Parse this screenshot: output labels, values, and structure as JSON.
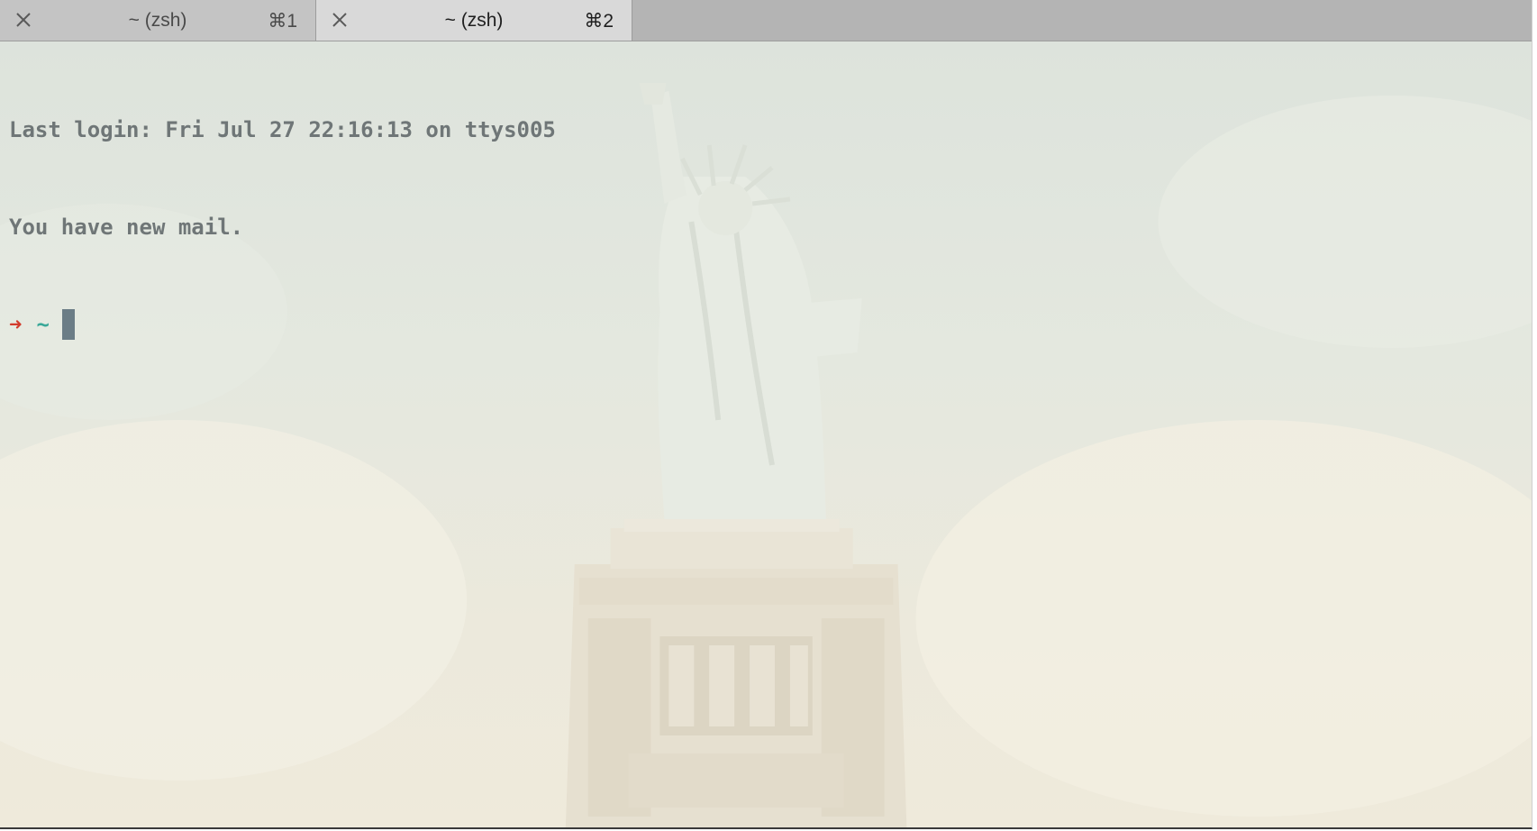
{
  "tabs": [
    {
      "title": "~ (zsh)",
      "shortcut": "⌘1",
      "active": false,
      "close_icon": "close-icon"
    },
    {
      "title": "~ (zsh)",
      "shortcut": "⌘2",
      "active": true,
      "close_icon": "close-icon"
    }
  ],
  "terminal": {
    "lines": [
      "Last login: Fri Jul 27 22:16:13 on ttys005",
      "You have new mail."
    ],
    "prompt": {
      "arrow": "➜",
      "cwd": "~"
    },
    "background_image": "statue-of-liberty"
  },
  "colors": {
    "prompt_arrow": "#d23b2c",
    "prompt_cwd": "#3aa898",
    "text": "#6f7677",
    "cursor": "#6b7d86"
  }
}
